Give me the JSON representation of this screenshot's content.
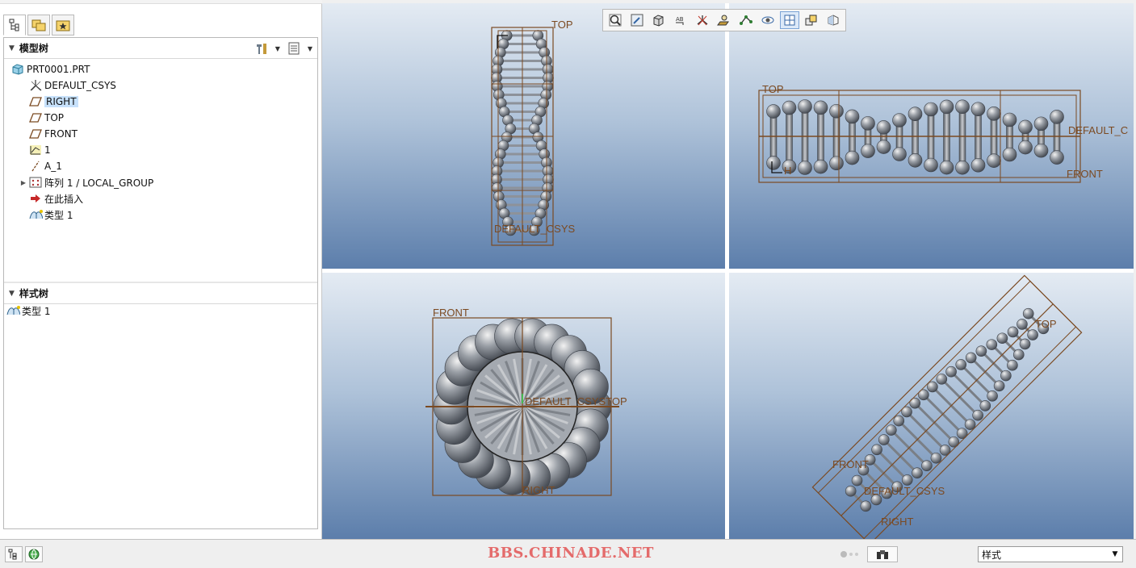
{
  "navigator": {
    "tabs": [
      {
        "name": "model-tree-tab-icon",
        "active": true
      },
      {
        "name": "folder-browser-tab-icon",
        "active": false
      },
      {
        "name": "favorites-tab-icon",
        "active": false
      }
    ],
    "model_tree": {
      "header": "模型树",
      "items": [
        {
          "label": "PRT0001.PRT",
          "icon": "part-icon",
          "indent": 0,
          "expander": ""
        },
        {
          "label": "DEFAULT_CSYS",
          "icon": "csys-icon",
          "indent": 1,
          "expander": ""
        },
        {
          "label": "RIGHT",
          "icon": "datum-plane-icon",
          "indent": 1,
          "expander": "",
          "selected": true
        },
        {
          "label": "TOP",
          "icon": "datum-plane-icon",
          "indent": 1,
          "expander": ""
        },
        {
          "label": "FRONT",
          "icon": "datum-plane-icon",
          "indent": 1,
          "expander": ""
        },
        {
          "label": "1",
          "icon": "sketch-icon",
          "indent": 1,
          "expander": ""
        },
        {
          "label": "A_1",
          "icon": "axis-icon",
          "indent": 1,
          "expander": ""
        },
        {
          "label": "阵列 1 / LOCAL_GROUP",
          "icon": "pattern-icon",
          "indent": 1,
          "expander": "▶"
        },
        {
          "label": "在此插入",
          "icon": "insert-here-icon",
          "indent": 1,
          "expander": ""
        },
        {
          "label": "类型 1",
          "icon": "style-icon",
          "indent": 1,
          "expander": ""
        }
      ]
    },
    "style_tree": {
      "header": "样式树",
      "items": [
        {
          "label": "类型 1",
          "icon": "style-icon"
        }
      ]
    }
  },
  "viewports": {
    "top_left": {
      "labels": {
        "top": "TOP",
        "csys": "DEFAULT_CSYS",
        "h": "H"
      }
    },
    "top_right": {
      "labels": {
        "top": "TOP",
        "front": "FRONT",
        "csys": "DEFAULT_C",
        "h": "H"
      }
    },
    "bottom_left": {
      "labels": {
        "front": "FRONT",
        "csys_top": "DEFAULT_CSYSTOP",
        "right": "RIGHT"
      }
    },
    "bottom_right": {
      "labels": {
        "top": "TOP",
        "front": "FRONT",
        "csys": "DEFAULT_CSYS",
        "right": "RIGHT"
      }
    }
  },
  "view_toolbar": {
    "buttons": [
      {
        "name": "refit-icon"
      },
      {
        "name": "repaint-icon"
      },
      {
        "name": "display-style-icon"
      },
      {
        "name": "annotation-display-icon"
      },
      {
        "name": "csys-display-icon"
      },
      {
        "name": "plane-display-icon"
      },
      {
        "name": "point-display-icon"
      },
      {
        "name": "spin-center-icon"
      },
      {
        "name": "view-manager-icon",
        "active": true
      },
      {
        "name": "saved-views-icon"
      },
      {
        "name": "layers-icon"
      }
    ]
  },
  "status_bar": {
    "watermark": "BBS.CHINADE.NET",
    "filter_value": "样式",
    "colors": {
      "watermark": "#e46b6b",
      "datum": "#7b4a22"
    }
  }
}
